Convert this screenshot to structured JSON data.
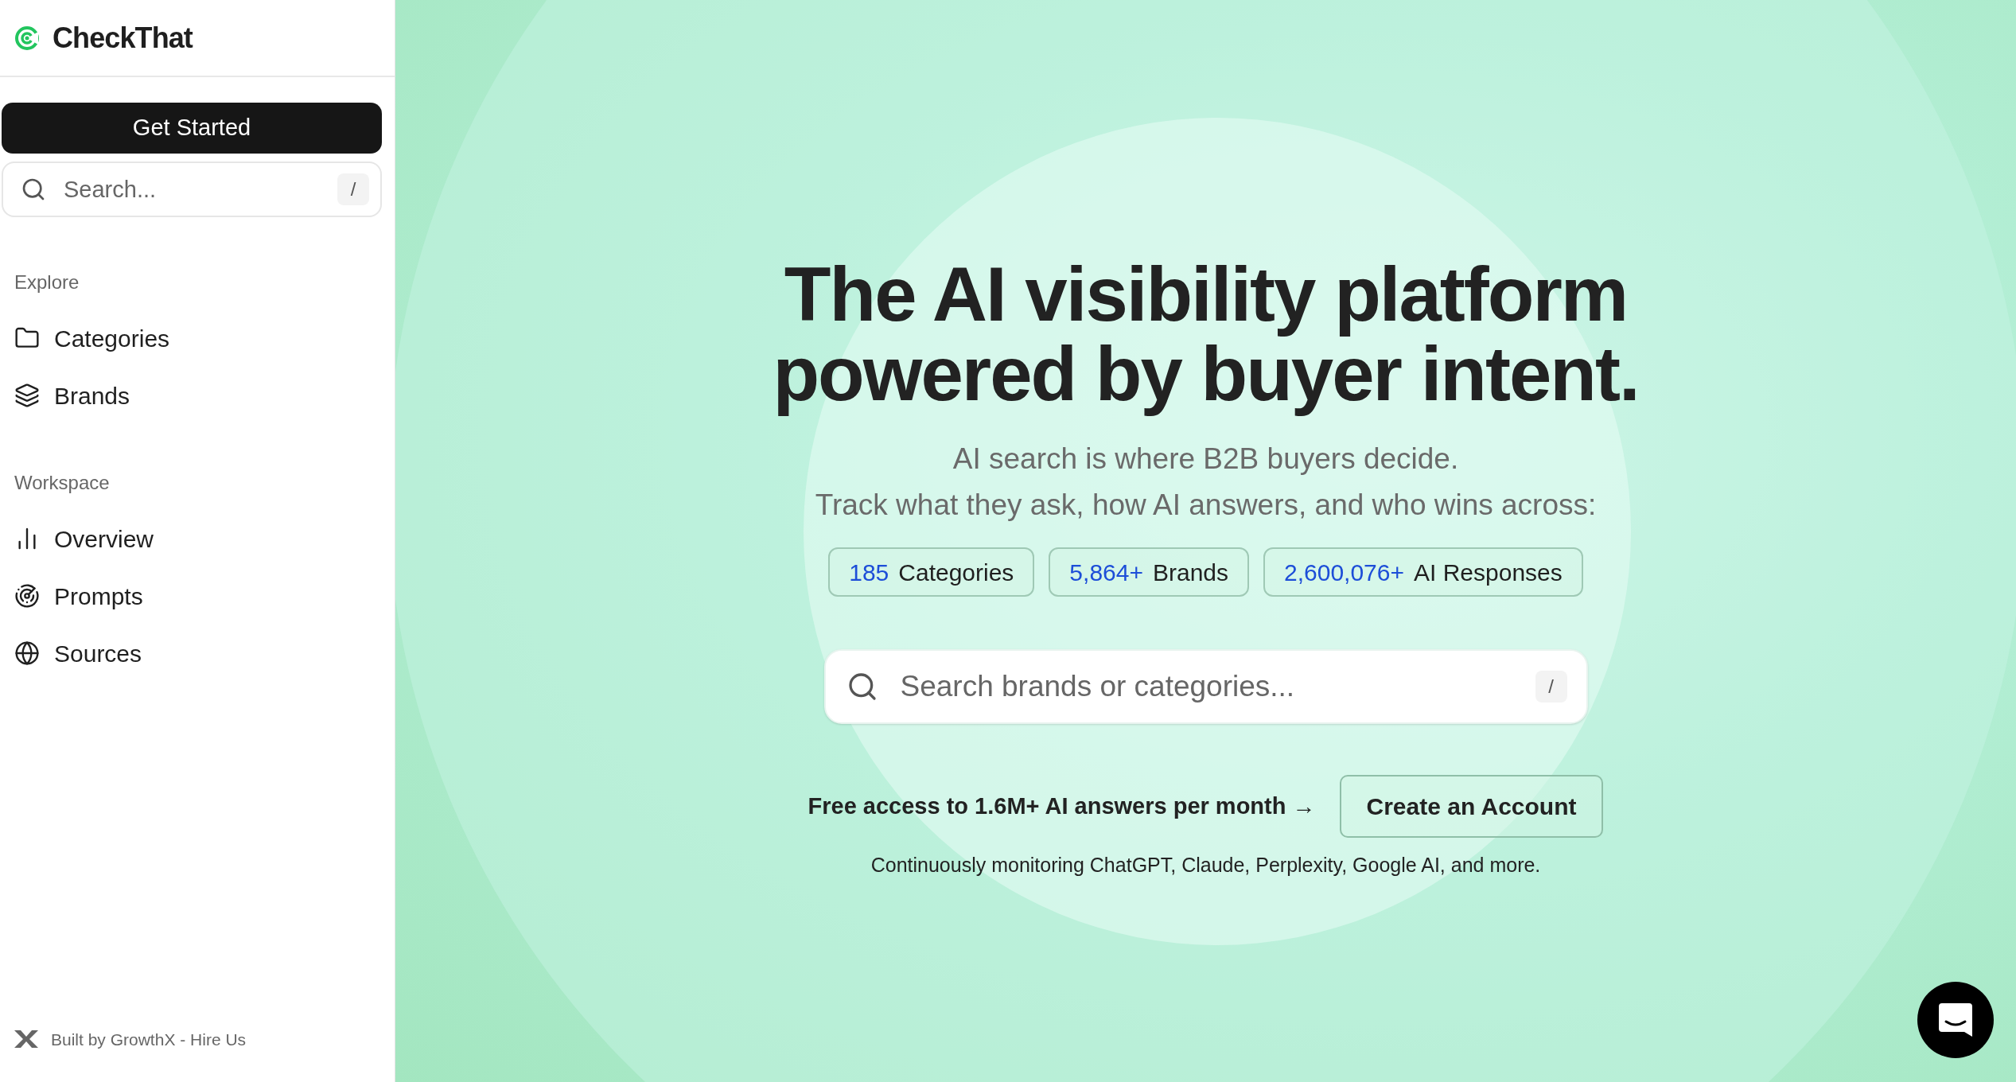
{
  "sidebar": {
    "logo": "CheckThat",
    "cta": "Get Started",
    "search": {
      "placeholder": "Search...",
      "shortcut": "/"
    },
    "sections": [
      {
        "title": "Explore",
        "items": [
          {
            "label": "Categories",
            "kind": "folder"
          },
          {
            "label": "Brands",
            "kind": "layers"
          }
        ]
      },
      {
        "title": "Workspace",
        "items": [
          {
            "label": "Overview",
            "kind": "chart"
          },
          {
            "label": "Prompts",
            "kind": "radar"
          },
          {
            "label": "Sources",
            "kind": "globe"
          }
        ]
      }
    ],
    "footer": "Built by GrowthX - Hire Us"
  },
  "hero": {
    "title_lines": [
      "The AI visibility platform",
      "powered by buyer intent."
    ],
    "subtitle_lines": [
      "AI search is where B2B buyers decide.",
      "Track what they ask, how AI answers, and who wins across:"
    ],
    "stats": [
      {
        "value": "185",
        "label": "Categories"
      },
      {
        "value": "5,864+",
        "label": "Brands"
      },
      {
        "value": "2,600,076+",
        "label": "AI Responses"
      }
    ],
    "search": {
      "placeholder": "Search brands or categories...",
      "shortcut": "/"
    },
    "free_access_link": "Free access to 1.6M+ AI answers per month →",
    "create_account": "Create an Account",
    "monitoring_note": "Continuously monitoring ChatGPT, Claude, Perplexity, Google AI, and more."
  }
}
